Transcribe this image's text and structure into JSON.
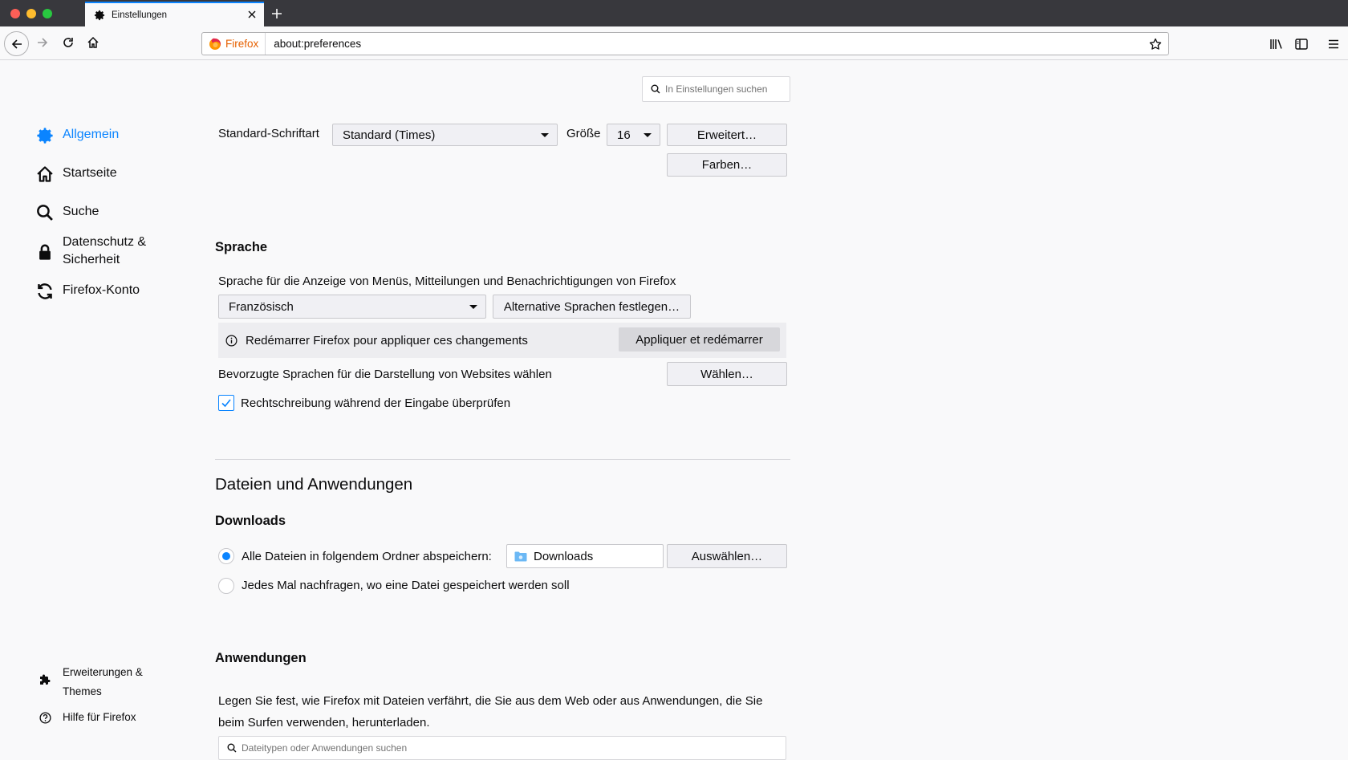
{
  "browser": {
    "tab_title": "Einstellungen",
    "identity_label": "Firefox",
    "url": "about:preferences"
  },
  "search": {
    "placeholder": "In Einstellungen suchen"
  },
  "sidebar": {
    "categories": [
      {
        "label": "Allgemein",
        "icon": "gear-icon",
        "selected": true
      },
      {
        "label": "Startseite",
        "icon": "home-icon"
      },
      {
        "label": "Suche",
        "icon": "search-icon"
      },
      {
        "label": "Datenschutz &",
        "label2": "Sicherheit",
        "icon": "lock-icon"
      },
      {
        "label": "Firefox-Konto",
        "icon": "sync-icon"
      }
    ],
    "footer": [
      {
        "label": "Erweiterungen &",
        "label2": "Themes",
        "icon": "puzzle-icon"
      },
      {
        "label": "Hilfe für Firefox",
        "icon": "help-icon"
      }
    ]
  },
  "fonts": {
    "label": "Standard-Schriftart",
    "font_value": "Standard (Times)",
    "size_label": "Größe",
    "size_value": "16",
    "advanced_button": "Erweitert…",
    "colors_button": "Farben…"
  },
  "language": {
    "heading": "Sprache",
    "description": "Sprache für die Anzeige von Menüs, Mitteilungen und Benachrichtigungen von Firefox",
    "selected_language": "Französisch",
    "alt_languages_button": "Alternative Sprachen festlegen…",
    "restart_message": "Redémarrer Firefox pour appliquer ces changements",
    "restart_button": "Appliquer et redémarrer",
    "web_languages_label": "Bevorzugte Sprachen für die Darstellung von Websites wählen",
    "web_languages_button": "Wählen…",
    "spellcheck_label": "Rechtschreibung während der Eingabe überprüfen",
    "spellcheck_checked": true
  },
  "files": {
    "heading": "Dateien und Anwendungen",
    "downloads_heading": "Downloads",
    "save_to_label": "Alle Dateien in folgendem Ordner abspeichern:",
    "folder_name": "Downloads",
    "choose_button": "Auswählen…",
    "always_ask_label": "Jedes Mal nachfragen, wo eine Datei gespeichert werden soll",
    "apps_heading": "Anwendungen",
    "apps_description_1": "Legen Sie fest, wie Firefox mit Dateien verfährt, die Sie aus dem Web oder aus Anwendungen, die Sie",
    "apps_description_2": "beim Surfen verwenden, herunterladen.",
    "filter_placeholder": "Dateitypen oder Anwendungen suchen"
  },
  "colors": {
    "accent": "#0a84ff",
    "tabbar": "#38383d",
    "firefox_orange": "#e66000"
  }
}
